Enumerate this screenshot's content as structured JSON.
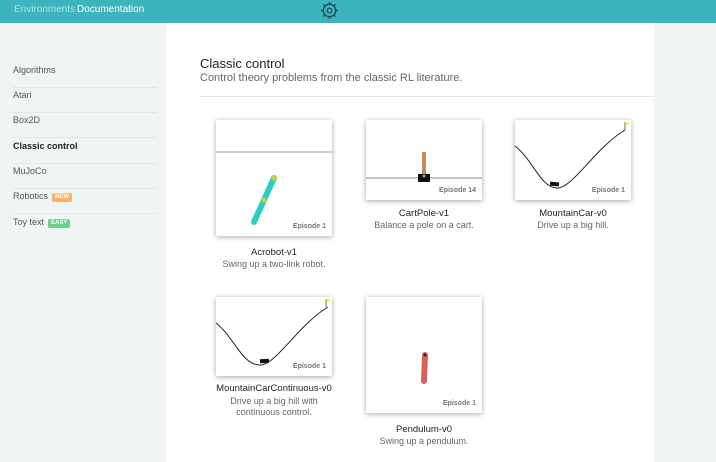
{
  "nav": {
    "environments": "Environments",
    "documentation": "Documentation",
    "logo_icon": "gym-logo-icon"
  },
  "sidebar": {
    "items": [
      {
        "label": "Algorithms",
        "badge": ""
      },
      {
        "label": "Atari",
        "badge": ""
      },
      {
        "label": "Box2D",
        "badge": ""
      },
      {
        "label": "Classic control",
        "badge": "",
        "active": true
      },
      {
        "label": "MuJoCo",
        "badge": ""
      },
      {
        "label": "Robotics",
        "badge": "NEW"
      },
      {
        "label": "Toy text",
        "badge": "EASY"
      }
    ]
  },
  "section": {
    "title": "Classic control",
    "subtitle": "Control theory problems from the classic RL literature."
  },
  "environments": [
    {
      "name": "Acrobot-v1",
      "description": "Swing up a two-link robot.",
      "episode": "Episode 1"
    },
    {
      "name": "CartPole-v1",
      "description": "Balance a pole on a cart.",
      "episode": "Episode 14"
    },
    {
      "name": "MountainCar-v0",
      "description": "Drive up a big hill.",
      "episode": "Episode 1"
    },
    {
      "name": "MountainCarContinuous-v0",
      "description_lines": [
        "Drive up a big hill with",
        "continuous control."
      ],
      "episode": "Episode 1"
    },
    {
      "name": "Pendulum-v0",
      "description": "Swing up a pendulum.",
      "episode": "Episode 1"
    }
  ],
  "colors": {
    "accent": "#3bb5bd",
    "new_badge": "#f5b46a",
    "easy_badge": "#6dcf8e",
    "pendulum": "#d9605a",
    "acrobot_link": "#2ccbc4",
    "acrobot_joint": "#c9cf3c"
  }
}
